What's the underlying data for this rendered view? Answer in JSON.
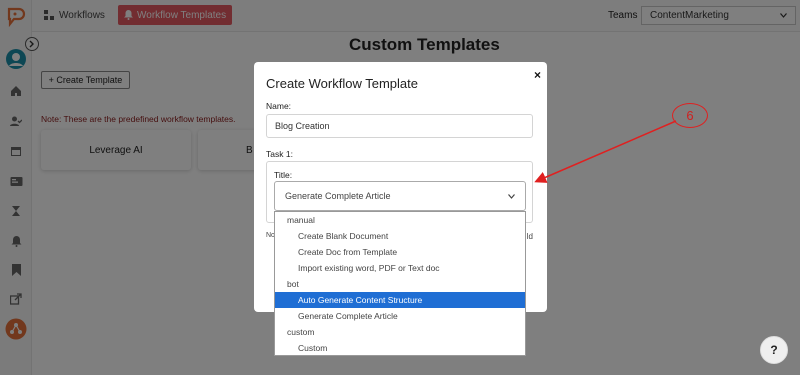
{
  "topbar": {
    "tabs": [
      {
        "label": "Workflows",
        "icon": "workflow-icon"
      },
      {
        "label": "Workflow Templates",
        "icon": "bell-template-icon"
      }
    ],
    "teams_label": "Teams",
    "teams_value": "ContentMarketing"
  },
  "main": {
    "title": "Custom Templates",
    "create_button": "+ Create Template",
    "note": "Note: These are the predefined workflow templates.",
    "cards": [
      "Leverage AI",
      "B"
    ]
  },
  "modal": {
    "title": "Create Workflow Template",
    "close": "×",
    "name_label": "Name:",
    "name_value": "Blog Creation",
    "task_label": "Task 1:",
    "title_label": "Title:",
    "title_value": "Generate Complete Article",
    "note_fragment_left": "No",
    "note_fragment_right": "ld"
  },
  "dropdown": {
    "groups": [
      {
        "label": "manual",
        "options": [
          "Create Blank Document",
          "Create Doc from Template",
          "Import existing word, PDF or Text doc"
        ]
      },
      {
        "label": "bot",
        "options": [
          "Auto Generate Content Structure",
          "Generate Complete Article"
        ]
      },
      {
        "label": "custom",
        "options": [
          "Custom"
        ]
      }
    ],
    "highlighted": "Auto Generate Content Structure"
  },
  "annotation": {
    "label": "6",
    "color": "#e02020"
  },
  "help": {
    "label": "?"
  },
  "sidebar": {
    "icons": [
      "logo-icon",
      "avatar-icon",
      "home-icon",
      "user-check-icon",
      "calendar-icon",
      "id-card-icon",
      "hourglass-icon",
      "bell-icon",
      "bookmark-icon",
      "share-icon",
      "workflow-active-icon"
    ]
  },
  "colors": {
    "accent": "#e55a63",
    "select_highlight": "#1f6ed4"
  }
}
